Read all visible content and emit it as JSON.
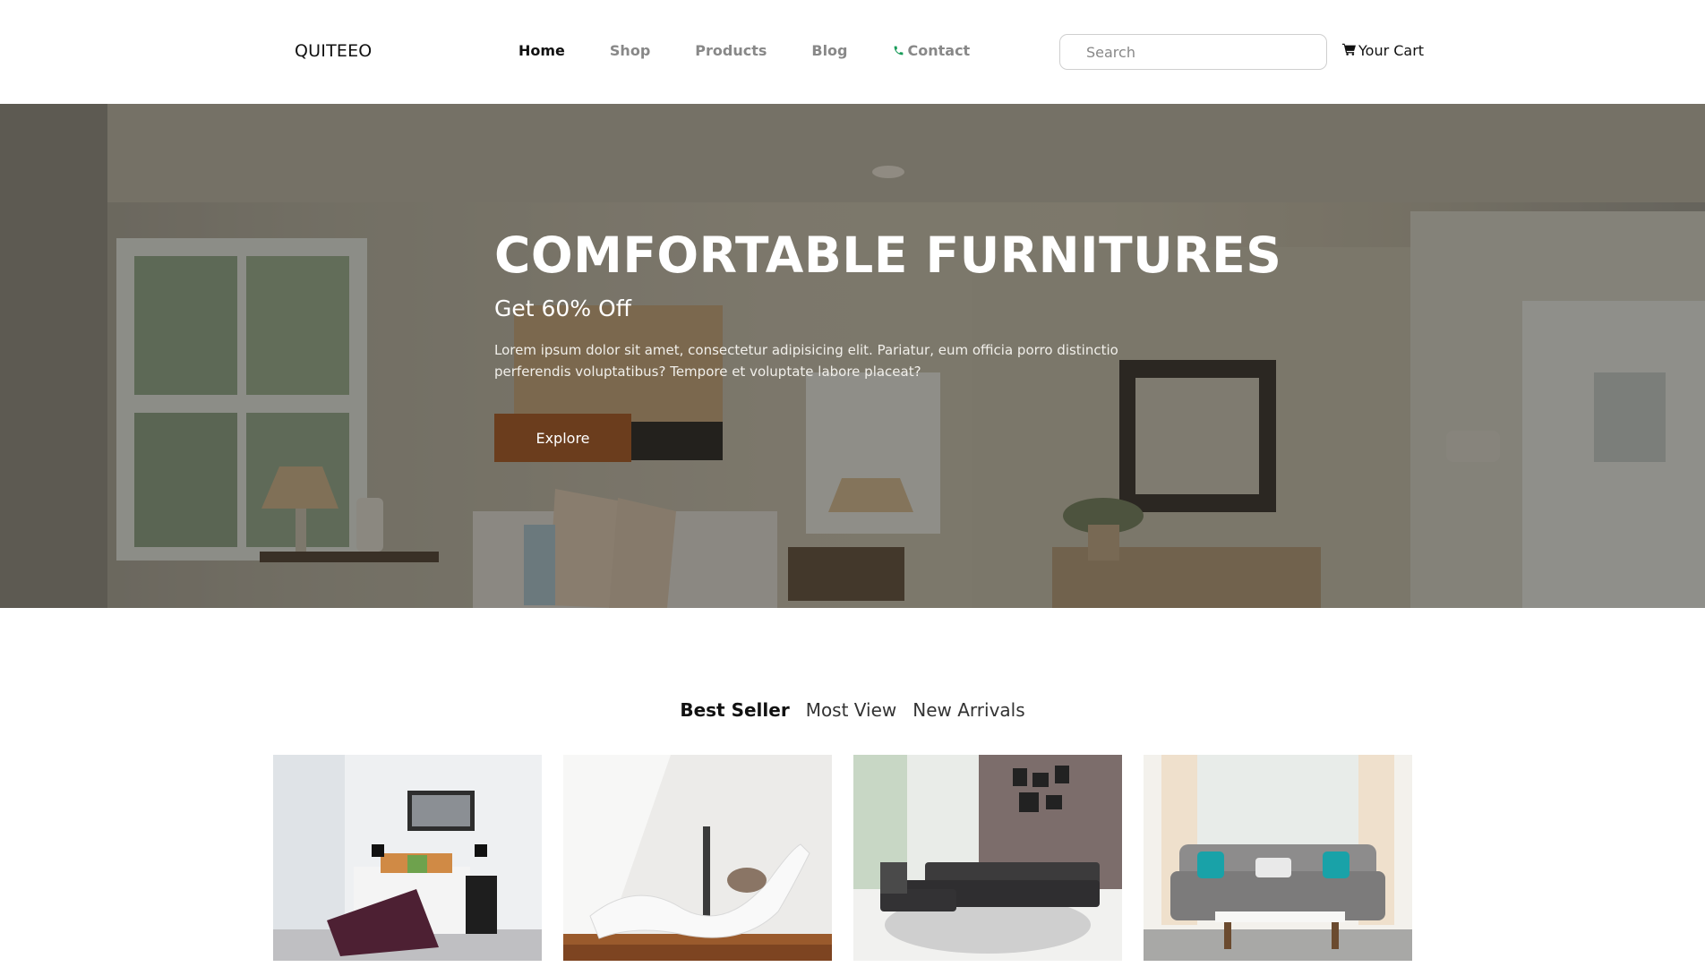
{
  "brand": {
    "logo": "QUITEEO"
  },
  "nav": {
    "items": [
      {
        "label": "Home",
        "active": true
      },
      {
        "label": "Shop",
        "active": false
      },
      {
        "label": "Products",
        "active": false
      },
      {
        "label": "Blog",
        "active": false
      },
      {
        "label": "Contact",
        "active": false,
        "icon": "phone-icon"
      }
    ]
  },
  "search": {
    "placeholder": "Search",
    "value": ""
  },
  "cart": {
    "label": "Your Cart",
    "icon": "cart-icon"
  },
  "hero": {
    "title": "COMFORTABLE FURNITURES",
    "subtitle": "Get 60% Off",
    "text": "Lorem ipsum dolor sit amet, consectetur adipisicing elit. Pariatur, eum officia porro distinctio perferendis voluptatibus? Tempore et voluptate labore placeat?",
    "button_label": "Explore",
    "button_color": "#6b3d1d"
  },
  "tabs": [
    {
      "label": "Best Seller",
      "active": true
    },
    {
      "label": "Most View",
      "active": false
    },
    {
      "label": "New Arrivals",
      "active": false
    }
  ],
  "products": [
    {
      "image": "bedroom-photo"
    },
    {
      "image": "white-chaise-lounge-photo"
    },
    {
      "image": "dark-sectional-sofa-photo"
    },
    {
      "image": "grey-sofa-living-room-photo"
    }
  ],
  "colors": {
    "accent_brown": "#6b3d1d",
    "contact_icon_green": "#1a9c5a"
  }
}
